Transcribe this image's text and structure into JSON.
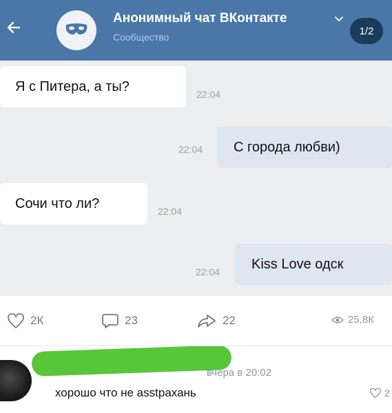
{
  "header": {
    "title": "Анонимный чат ВКонтакте",
    "subtitle": "Сообщество",
    "page_indicator": "1/2",
    "colors": {
      "bar": "#4a76a8",
      "badge": "#1b3b5a"
    },
    "icons": {
      "back": "arrow-left-icon",
      "avatar": "mask-icon",
      "dropdown": "chevron-down-icon"
    }
  },
  "messages": [
    {
      "direction": "incoming",
      "text": "Я с Питера, а ты?",
      "time": "22:04"
    },
    {
      "direction": "outgoing",
      "text": "С города любви)",
      "time": "22:04"
    },
    {
      "direction": "incoming",
      "text": "Сочи что ли?",
      "time": "22:04"
    },
    {
      "direction": "outgoing",
      "text": "Kiss Love одск",
      "time": "22:04"
    }
  ],
  "post_actions": {
    "likes": "2К",
    "comments": "23",
    "shares": "22",
    "views": "25,8К",
    "icons": {
      "likes": "heart-icon",
      "comments": "comment-icon",
      "shares": "share-icon",
      "views": "eye-icon"
    }
  },
  "comment": {
    "meta": "вчера в 20:02",
    "text": "хорошо что не asstрахань",
    "likes": "2",
    "redaction_color": "#58c63a"
  }
}
